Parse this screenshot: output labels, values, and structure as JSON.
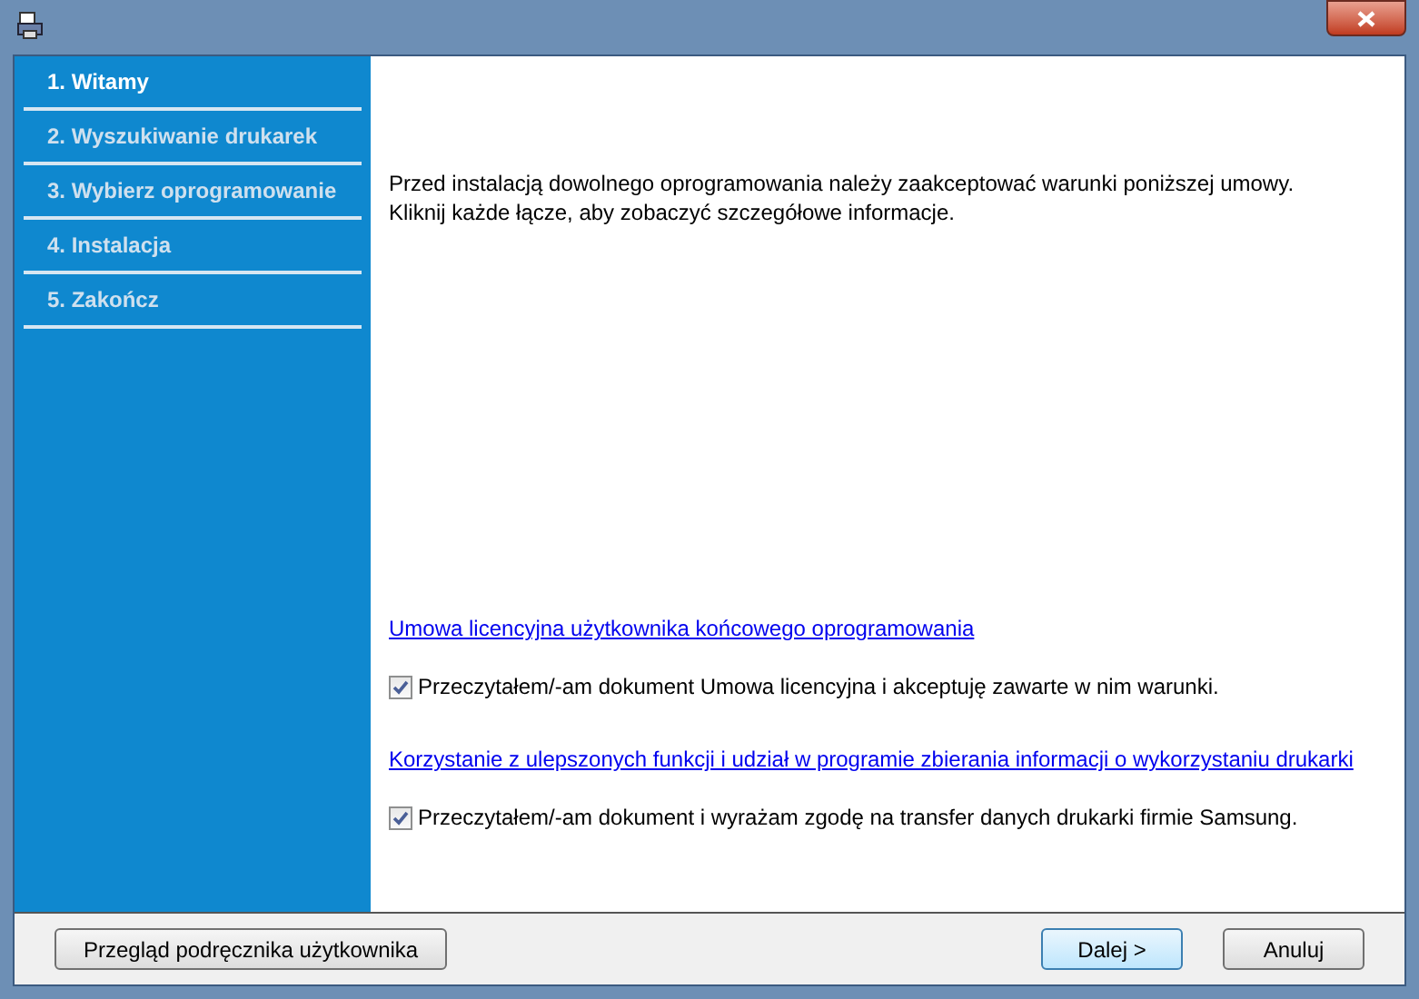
{
  "steps": [
    {
      "label": "1. Witamy",
      "selected": true
    },
    {
      "label": "2. Wyszukiwanie drukarek",
      "selected": false
    },
    {
      "label": "3. Wybierz oprogramowanie",
      "selected": false
    },
    {
      "label": "4. Instalacja",
      "selected": false
    },
    {
      "label": "5. Zakończ",
      "selected": false
    }
  ],
  "intro": [
    "Przed instalacją dowolnego oprogramowania należy zaakceptować warunki poniższej umowy.",
    "Kliknij każde łącze, aby zobaczyć szczegółowe informacje."
  ],
  "agreements": [
    {
      "link": "Umowa licencyjna użytkownika końcowego oprogramowania",
      "checkbox": "Przeczytałem/-am dokument Umowa licencyjna i akceptuję zawarte w nim warunki.",
      "checked": true
    },
    {
      "link": "Korzystanie z ulepszonych funkcji i udział w programie zbierania informacji o wykorzystaniu drukarki",
      "checkbox": "Przeczytałem/-am dokument i wyrażam zgodę na transfer danych drukarki firmie Samsung.",
      "checked": true
    }
  ],
  "buttons": {
    "guide": "Przegląd podręcznika użytkownika",
    "next": "Dalej >",
    "cancel": "Anuluj"
  }
}
